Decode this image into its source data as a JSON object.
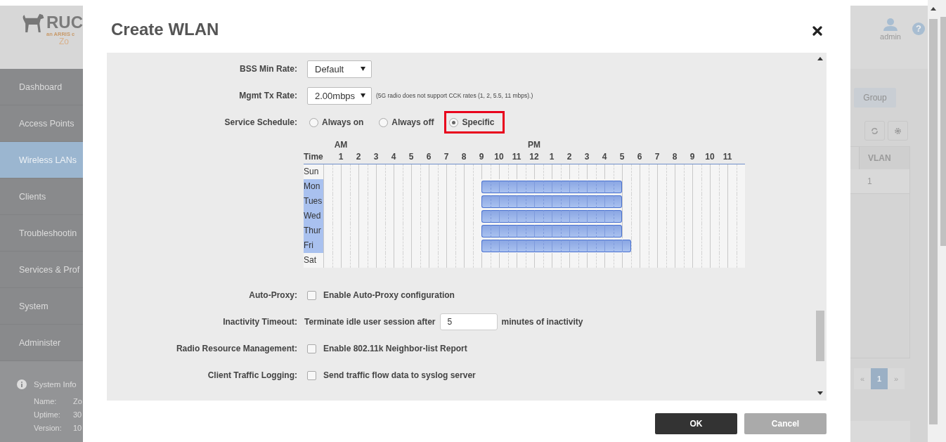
{
  "sidebar": {
    "logo": {
      "name": "RUC",
      "tagline": "an ARRIS c",
      "product": "Zo"
    },
    "items": [
      {
        "label": "Dashboard",
        "selected": false
      },
      {
        "label": "Access Points",
        "selected": false
      },
      {
        "label": "Wireless LANs",
        "selected": true
      },
      {
        "label": "Clients",
        "selected": false
      },
      {
        "label": "Troubleshootin",
        "selected": false
      },
      {
        "label": "Services & Prof",
        "selected": false
      },
      {
        "label": "System",
        "selected": false
      },
      {
        "label": "Administer",
        "selected": false
      }
    ],
    "system_info": {
      "title": "System Info",
      "rows": [
        {
          "label": "Name:",
          "value": "Zo"
        },
        {
          "label": "Uptime:",
          "value": "30"
        },
        {
          "label": "Version:",
          "value": "10"
        }
      ]
    }
  },
  "dialog": {
    "title": "Create WLAN",
    "form": [
      {
        "kind": "select",
        "label": "BSS Min Rate:",
        "value": "Default"
      },
      {
        "kind": "select",
        "label": "Mgmt Tx Rate:",
        "value": "2.00mbps",
        "note": "(5G radio does not support CCK rates (1, 2, 5.5, 11 mbps).)"
      },
      {
        "kind": "radio",
        "label": "Service Schedule:",
        "options": [
          {
            "label": "Always on",
            "selected": false,
            "highlighted": false
          },
          {
            "label": "Always off",
            "selected": false,
            "highlighted": false
          },
          {
            "label": "Specific",
            "selected": true,
            "highlighted": true
          }
        ]
      },
      {
        "kind": "schedule",
        "time_label": "Time",
        "hours": [
          {
            "label": "1",
            "period": "AM"
          },
          {
            "label": "2"
          },
          {
            "label": "3"
          },
          {
            "label": "4"
          },
          {
            "label": "5"
          },
          {
            "label": "6"
          },
          {
            "label": "7"
          },
          {
            "label": "8"
          },
          {
            "label": "9"
          },
          {
            "label": "10"
          },
          {
            "label": "11"
          },
          {
            "label": "12",
            "period": "PM"
          },
          {
            "label": "1"
          },
          {
            "label": "2"
          },
          {
            "label": "3"
          },
          {
            "label": "4"
          },
          {
            "label": "5"
          },
          {
            "label": "6"
          },
          {
            "label": "7"
          },
          {
            "label": "8"
          },
          {
            "label": "9"
          },
          {
            "label": "10"
          },
          {
            "label": "11"
          }
        ],
        "days": [
          {
            "label": "Sun",
            "selected": false,
            "half_hours": [
              false,
              false,
              false,
              false,
              false,
              false,
              false,
              false,
              false,
              false,
              false,
              false,
              false,
              false,
              false,
              false,
              false,
              false,
              false,
              false,
              false,
              false,
              false,
              false,
              false,
              false,
              false,
              false,
              false,
              false,
              false,
              false,
              false,
              false,
              false,
              false,
              false,
              false,
              false,
              false,
              false,
              false,
              false,
              false,
              false,
              false,
              false,
              false
            ]
          },
          {
            "label": "Mon",
            "selected": true,
            "half_hours": [
              false,
              false,
              false,
              false,
              false,
              false,
              false,
              false,
              false,
              false,
              false,
              false,
              false,
              false,
              false,
              false,
              false,
              false,
              true,
              true,
              true,
              true,
              true,
              true,
              true,
              true,
              true,
              true,
              true,
              true,
              true,
              true,
              true,
              true,
              false,
              false,
              false,
              false,
              false,
              false,
              false,
              false,
              false,
              false,
              false,
              false,
              false,
              false
            ]
          },
          {
            "label": "Tues",
            "selected": true,
            "half_hours": [
              false,
              false,
              false,
              false,
              false,
              false,
              false,
              false,
              false,
              false,
              false,
              false,
              false,
              false,
              false,
              false,
              false,
              false,
              true,
              true,
              true,
              true,
              true,
              true,
              true,
              true,
              true,
              true,
              true,
              true,
              true,
              true,
              true,
              true,
              false,
              false,
              false,
              false,
              false,
              false,
              false,
              false,
              false,
              false,
              false,
              false,
              false,
              false
            ]
          },
          {
            "label": "Wed",
            "selected": true,
            "half_hours": [
              false,
              false,
              false,
              false,
              false,
              false,
              false,
              false,
              false,
              false,
              false,
              false,
              false,
              false,
              false,
              false,
              false,
              false,
              true,
              true,
              true,
              true,
              true,
              true,
              true,
              true,
              true,
              true,
              true,
              true,
              true,
              true,
              true,
              true,
              false,
              false,
              false,
              false,
              false,
              false,
              false,
              false,
              false,
              false,
              false,
              false,
              false,
              false
            ]
          },
          {
            "label": "Thur",
            "selected": true,
            "half_hours": [
              false,
              false,
              false,
              false,
              false,
              false,
              false,
              false,
              false,
              false,
              false,
              false,
              false,
              false,
              false,
              false,
              false,
              false,
              true,
              true,
              true,
              true,
              true,
              true,
              true,
              true,
              true,
              true,
              true,
              true,
              true,
              true,
              true,
              true,
              false,
              false,
              false,
              false,
              false,
              false,
              false,
              false,
              false,
              false,
              false,
              false,
              false,
              false
            ]
          },
          {
            "label": "Fri",
            "selected": true,
            "half_hours": [
              false,
              false,
              false,
              false,
              false,
              false,
              false,
              false,
              false,
              false,
              false,
              false,
              false,
              false,
              false,
              false,
              false,
              false,
              true,
              true,
              true,
              true,
              true,
              true,
              true,
              true,
              true,
              true,
              true,
              true,
              true,
              true,
              true,
              true,
              true,
              false,
              false,
              false,
              false,
              false,
              false,
              false,
              false,
              false,
              false,
              false,
              false,
              false
            ]
          },
          {
            "label": "Sat",
            "selected": false,
            "half_hours": [
              false,
              false,
              false,
              false,
              false,
              false,
              false,
              false,
              false,
              false,
              false,
              false,
              false,
              false,
              false,
              false,
              false,
              false,
              false,
              false,
              false,
              false,
              false,
              false,
              false,
              false,
              false,
              false,
              false,
              false,
              false,
              false,
              false,
              false,
              false,
              false,
              false,
              false,
              false,
              false,
              false,
              false,
              false,
              false,
              false,
              false,
              false,
              false
            ]
          }
        ]
      },
      {
        "kind": "checkbox",
        "label": "Auto-Proxy:",
        "text": "Enable Auto-Proxy configuration",
        "checked": false
      },
      {
        "kind": "number",
        "label": "Inactivity Timeout:",
        "before": "Terminate idle user session after",
        "value": "5",
        "after": "minutes of inactivity"
      },
      {
        "kind": "checkbox",
        "label": "Radio Resource Management:",
        "text": "Enable 802.11k Neighbor-list Report",
        "checked": false
      },
      {
        "kind": "checkbox",
        "label": "Client Traffic Logging:",
        "text": "Send traffic flow data to syslog server",
        "checked": false
      }
    ],
    "buttons": [
      {
        "label": "OK",
        "kind": "primary"
      },
      {
        "label": "Cancel",
        "kind": "secondary"
      }
    ]
  },
  "background": {
    "user": "admin",
    "help": "?",
    "tab": "Group",
    "table": {
      "columns": [
        "VLAN"
      ],
      "rows": [
        [
          "1"
        ]
      ]
    },
    "pagination": {
      "prev": "«",
      "pages": [
        {
          "label": "1",
          "selected": true
        }
      ],
      "next": "»"
    }
  }
}
